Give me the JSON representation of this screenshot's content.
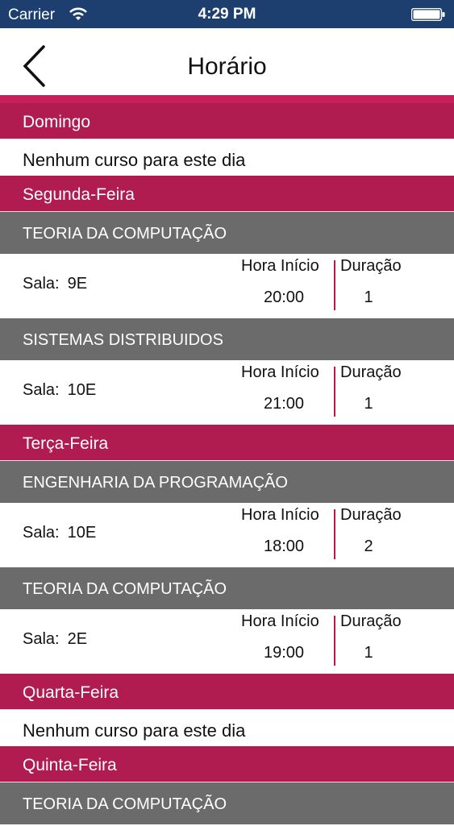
{
  "status": {
    "carrier": "Carrier",
    "time": "4:29 PM"
  },
  "nav": {
    "title": "Horário"
  },
  "labels": {
    "hora_inicio": "Hora Início",
    "duracao": "Duração",
    "sala": "Sala:"
  },
  "days": [
    {
      "name": "Domingo",
      "empty": "Nenhum curso para este dia"
    },
    {
      "name": "Segunda-Feira",
      "courses": [
        {
          "title": "TEORIA DA COMPUTAÇÃO",
          "sala": "9E",
          "hora": "20:00",
          "duracao": "1"
        },
        {
          "title": "SISTEMAS DISTRIBUIDOS",
          "sala": "10E",
          "hora": "21:00",
          "duracao": "1"
        }
      ]
    },
    {
      "name": "Terça-Feira",
      "courses": [
        {
          "title": "ENGENHARIA DA PROGRAMAÇÃO",
          "sala": "10E",
          "hora": "18:00",
          "duracao": "2"
        },
        {
          "title": "TEORIA DA COMPUTAÇÃO",
          "sala": "2E",
          "hora": "19:00",
          "duracao": "1"
        }
      ]
    },
    {
      "name": "Quarta-Feira",
      "empty": "Nenhum curso para este dia"
    },
    {
      "name": "Quinta-Feira",
      "courses": [
        {
          "title": "TEORIA DA COMPUTAÇÃO"
        }
      ]
    }
  ]
}
